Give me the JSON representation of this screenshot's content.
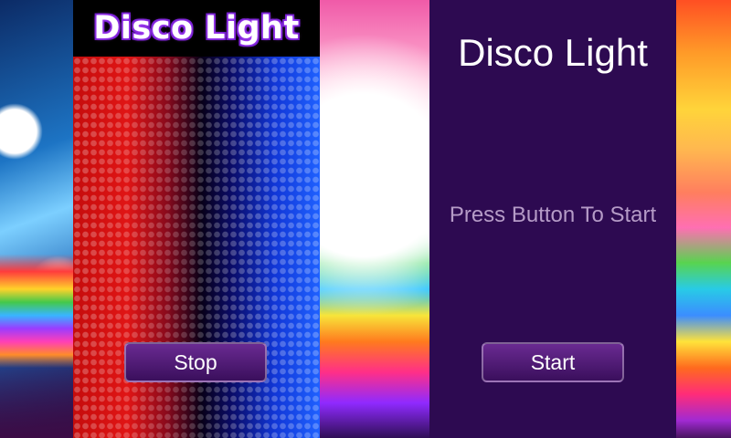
{
  "app": {
    "title": "Disco Light"
  },
  "running_screen": {
    "title": "Disco Light",
    "button_label": "Stop"
  },
  "idle_screen": {
    "title": "Disco Light",
    "status_text": "Press Button To Start",
    "button_label": "Start"
  },
  "colors": {
    "idle_background": "#2d0a51",
    "button_fill": "#4b1b72",
    "title_glow": "#b44cff",
    "status_text": "#b59bc7"
  },
  "icons": {
    "sparkle": "✦"
  }
}
